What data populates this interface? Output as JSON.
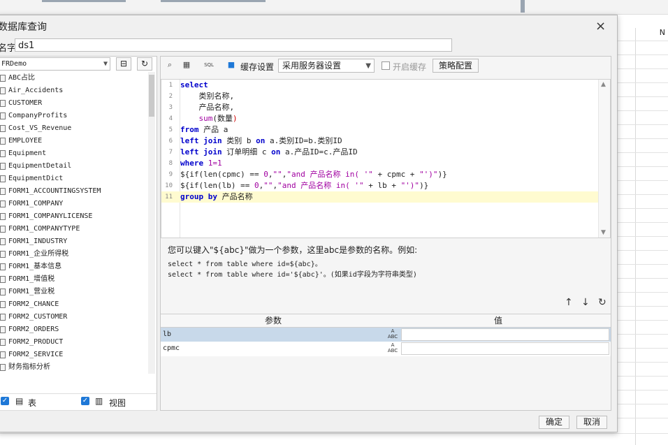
{
  "dialog": {
    "title": "数据库查询",
    "close_icon": "×"
  },
  "name_field": {
    "label": "名字:",
    "value": "ds1"
  },
  "connection": {
    "selected": "FRDemo"
  },
  "tables": [
    "ABC占比",
    "Air_Accidents",
    "CUSTOMER",
    "CompanyProfits",
    "Cost_VS_Revenue",
    "EMPLOYEE",
    "Equipment",
    "EquipmentDetail",
    "EquipmentDict",
    "FORM1_ACCOUNTINGSYSTEM",
    "FORM1_COMPANY",
    "FORM1_COMPANYLICENSE",
    "FORM1_COMPANYTYPE",
    "FORM1_INDUSTRY",
    "FORM1_企业所得税",
    "FORM1_基本信息",
    "FORM1_增值税",
    "FORM1_营业税",
    "FORM2_CHANCE",
    "FORM2_CUSTOMER",
    "FORM2_ORDERS",
    "FORM2_PRODUCT",
    "FORM2_SERVICE",
    "财务指标分析"
  ],
  "filters": {
    "table_label": "表",
    "view_label": "视图"
  },
  "toolbar": {
    "cache_label": "缓存设置",
    "cache_option": "采用服务器设置",
    "enable_cache_label": "开启缓存",
    "strategy_label": "策略配置"
  },
  "sql_lines": [
    [
      [
        "select",
        "k"
      ]
    ],
    [
      [
        "    类别名称,",
        ""
      ]
    ],
    [
      [
        "    产品名称,",
        ""
      ]
    ],
    [
      [
        "    ",
        "",
        ""
      ],
      [
        "sum",
        "f"
      ],
      [
        "(数量",
        ""
      ],
      [
        ")",
        "p"
      ]
    ],
    [
      [
        "from",
        "k"
      ],
      [
        " 产品 a",
        ""
      ]
    ],
    [
      [
        "left join",
        "k"
      ],
      [
        " 类别 b ",
        ""
      ],
      [
        "on",
        "k"
      ],
      [
        " a.类别ID=b.类别ID",
        ""
      ]
    ],
    [
      [
        "left join",
        "k"
      ],
      [
        " 订单明细 c ",
        ""
      ],
      [
        "on",
        "k"
      ],
      [
        " a.产品ID=c.产品ID",
        ""
      ]
    ],
    [
      [
        "where",
        "k"
      ],
      [
        " 1=1",
        "f"
      ]
    ],
    [
      [
        "${if(len(cpmc) == ",
        ""
      ],
      [
        "0",
        "f"
      ],
      [
        ",",
        ""
      ],
      [
        "\"\"",
        "s"
      ],
      [
        ",",
        ""
      ],
      [
        "\"and 产品名称 in( '\"",
        "s"
      ],
      [
        " + cpmc + ",
        ""
      ],
      [
        "\"')\"",
        "s"
      ],
      [
        ")}",
        ""
      ]
    ],
    [
      [
        "${if(len(lb) == ",
        ""
      ],
      [
        "0",
        "f"
      ],
      [
        ",",
        ""
      ],
      [
        "\"\"",
        "s"
      ],
      [
        ",",
        ""
      ],
      [
        "\"and 产品名称 in( '\"",
        "s"
      ],
      [
        " + lb + ",
        ""
      ],
      [
        "\"')\"",
        "s"
      ],
      [
        ")}",
        ""
      ]
    ],
    [
      [
        "group by",
        "k"
      ],
      [
        " 产品名称",
        ""
      ]
    ]
  ],
  "hint": {
    "line1": "您可以键入\"${abc}\"做为一个参数，这里abc是参数的名称。例如:",
    "line2": "select * from table where id=${abc}。",
    "line3": "select * from table where id='${abc}'。(如果id字段为字符串类型)"
  },
  "param_table": {
    "col_param": "参数",
    "col_value": "值",
    "rows": [
      {
        "name": "lb",
        "value": ""
      },
      {
        "name": "cpmc",
        "value": ""
      }
    ]
  },
  "footer": {
    "ok_label": "确定",
    "cancel_label": "取消"
  },
  "sheet": {
    "col_header": "N"
  },
  "colors": {
    "keyword": "#0000cc",
    "function": "#a000a0",
    "string": "#a000a0",
    "paren": "#d00000",
    "highlight": "#fffbd0"
  }
}
